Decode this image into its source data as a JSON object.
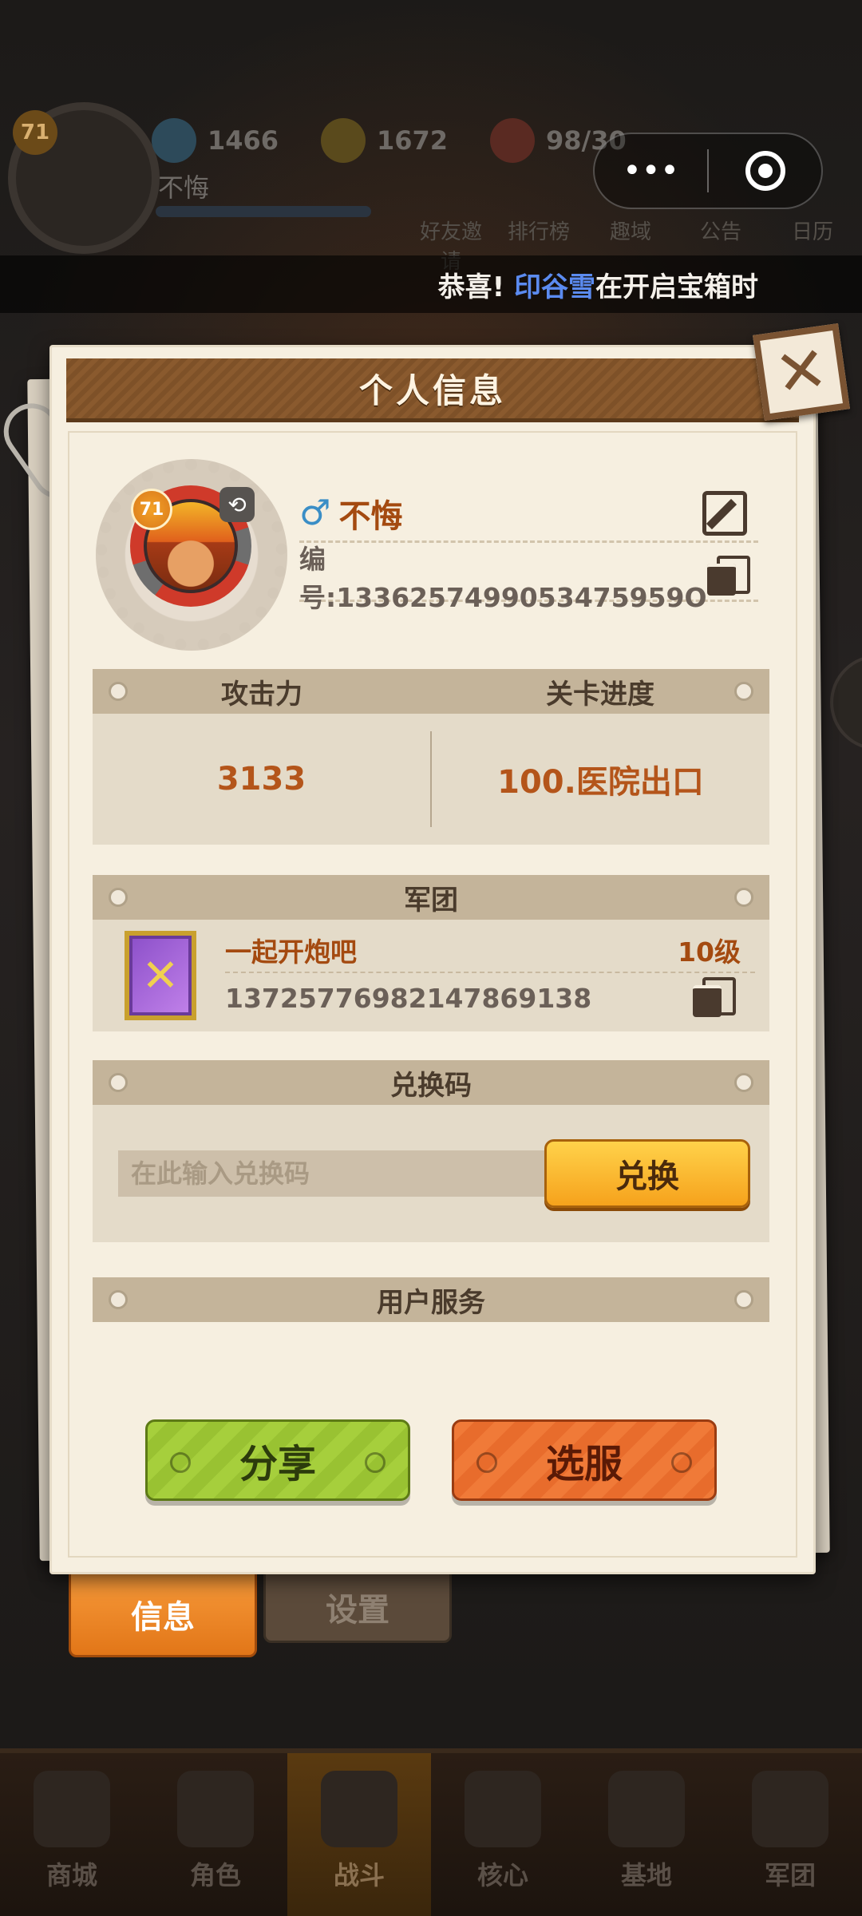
{
  "hud": {
    "player_level": "71",
    "player_name": "不悔",
    "gems": "1466",
    "coins": "1672",
    "stamina": "98/30",
    "menu_items": [
      "好友邀请",
      "排行榜",
      "趣域",
      "公告",
      "日历"
    ]
  },
  "capsule": {
    "more_label": "•••"
  },
  "ticker": {
    "prefix": "恭喜!",
    "highlight": "印谷雪",
    "suffix": "在开启宝箱时"
  },
  "panel": {
    "title": "个人信息",
    "close_label": "✕",
    "profile": {
      "level": "71",
      "swap_label": "⟲",
      "gender": "♂",
      "name": "不悔",
      "id_text": "编号:1336257499053475959O"
    },
    "stats": {
      "attack_label": "攻击力",
      "progress_label": "关卡进度",
      "attack_value": "3133",
      "progress_value": "100.医院出口"
    },
    "guild": {
      "header": "军团",
      "name": "一起开炮吧",
      "level": "10级",
      "id": "1372577698214786913​8"
    },
    "redeem": {
      "header": "兑换码",
      "placeholder": "在此输入兑换码",
      "button": "兑换"
    },
    "services": {
      "header": "用户服务"
    },
    "share_button": "分享",
    "server_button": "选服"
  },
  "tabs": {
    "info": "信息",
    "settings": "设置"
  },
  "bottom_nav": [
    "商城",
    "角色",
    "战斗",
    "核心",
    "基地",
    "军团"
  ],
  "colors": {
    "accent_orange": "#f6a21c",
    "title_brown": "#8a5a2e",
    "name_orange": "#a44a10",
    "share_green": "#a6cf3c",
    "server_orange": "#f07a38"
  }
}
